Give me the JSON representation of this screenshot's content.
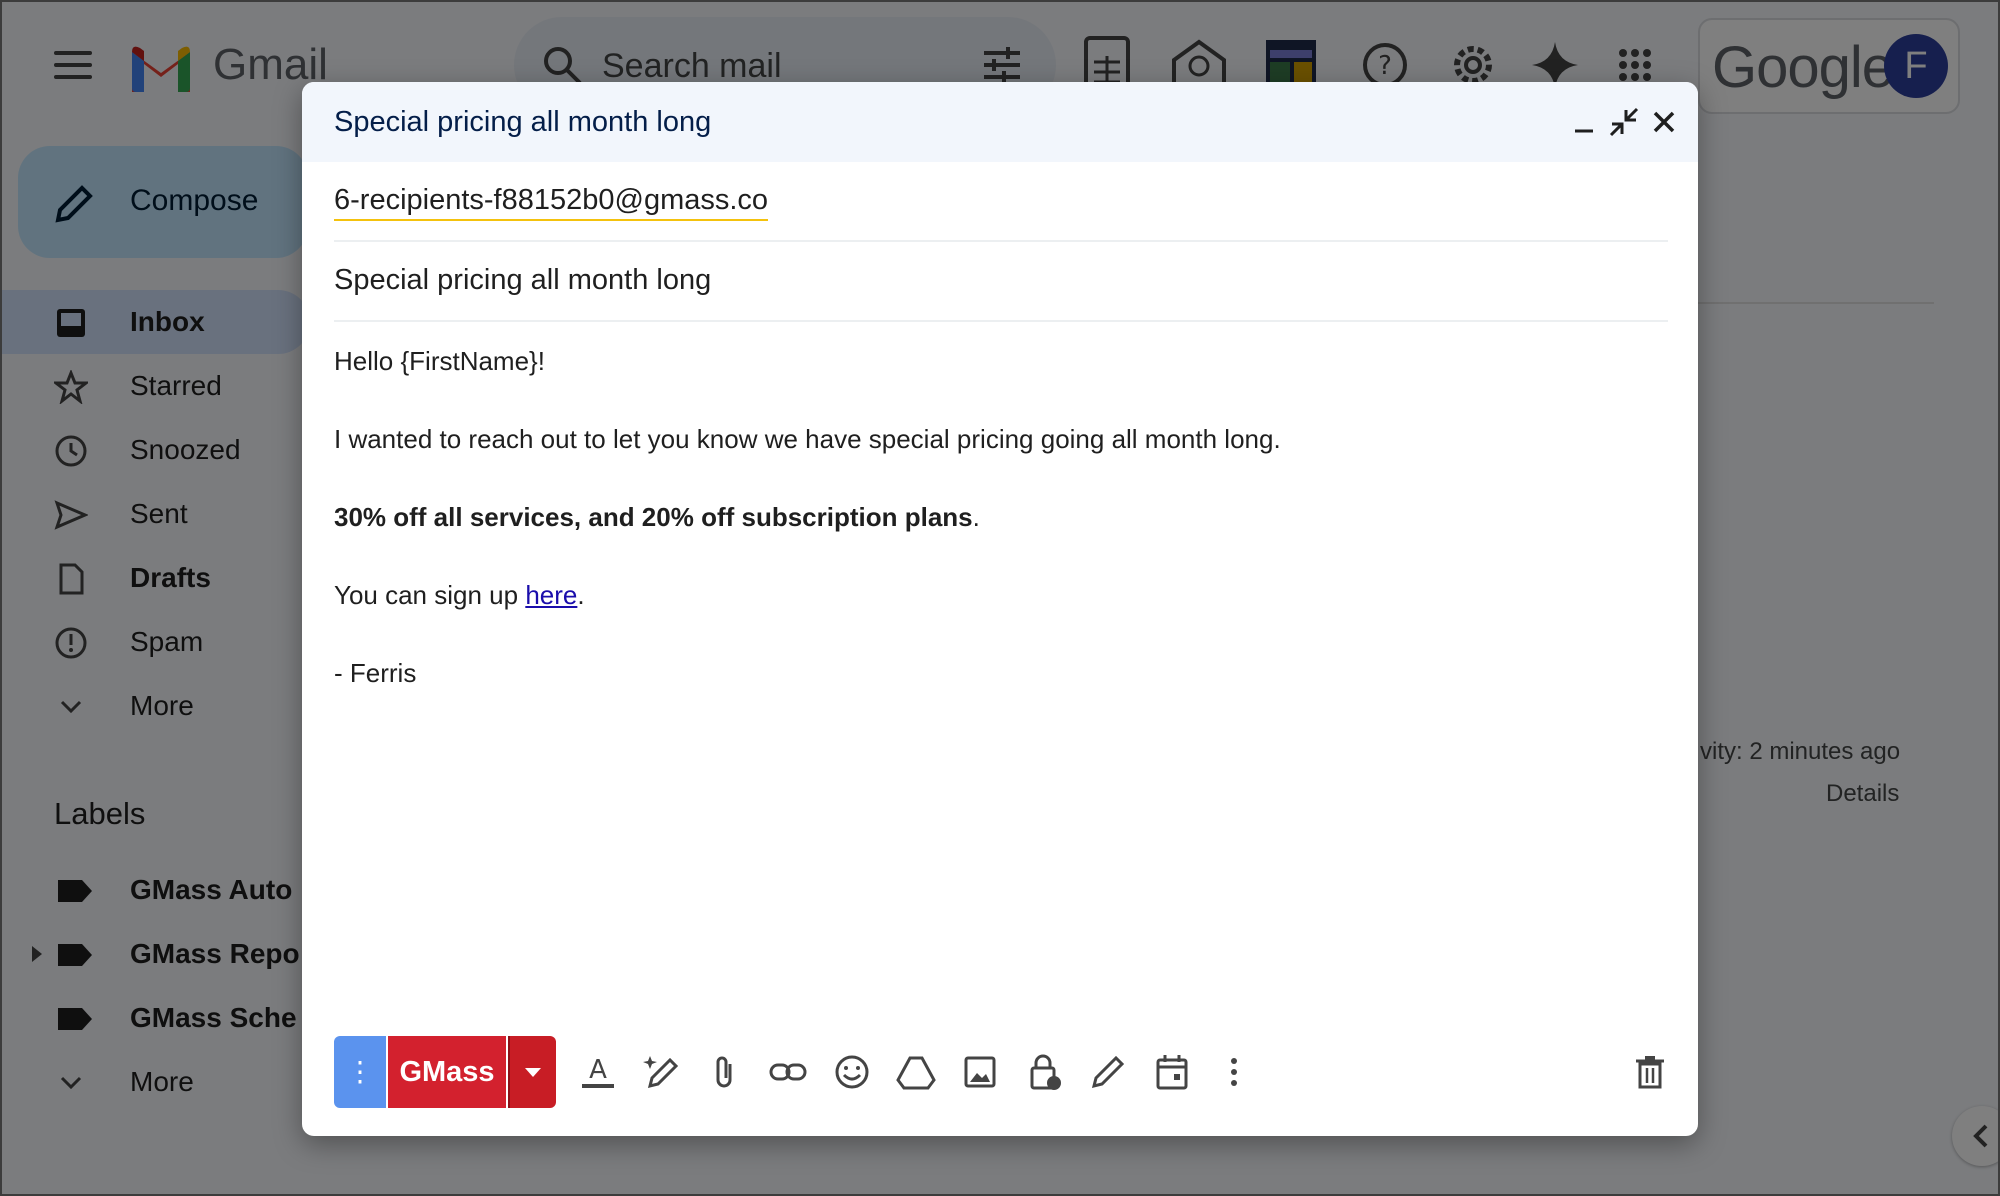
{
  "app": {
    "brand": "Gmail",
    "search_placeholder": "Search mail",
    "google_label": "Google",
    "avatar_initial": "F"
  },
  "sidebar": {
    "compose_label": "Compose",
    "items": [
      {
        "label": "Inbox",
        "icon": "inbox-icon",
        "active": true
      },
      {
        "label": "Starred",
        "icon": "star-icon"
      },
      {
        "label": "Snoozed",
        "icon": "clock-icon"
      },
      {
        "label": "Sent",
        "icon": "send-icon"
      },
      {
        "label": "Drafts",
        "icon": "draft-icon"
      },
      {
        "label": "Spam",
        "icon": "spam-icon"
      },
      {
        "label": "More",
        "icon": "chevron-down-icon"
      }
    ],
    "labels_heading": "Labels",
    "labels": [
      {
        "label": "GMass Auto"
      },
      {
        "label": "GMass Repo"
      },
      {
        "label": "GMass Sche"
      }
    ],
    "labels_more": "More"
  },
  "background": {
    "activity_text": "vity: 2 minutes ago",
    "details_text": "Details"
  },
  "compose": {
    "title": "Special pricing all month long",
    "recipient": "6-recipients-f88152b0@gmass.co",
    "subject": "Special pricing all month long",
    "body": {
      "greeting": "Hello {FirstName}!",
      "line1": "I wanted to reach out to let you know we have special pricing going all month long.",
      "offer_bold": "30% off all services, and 20% off subscription plans",
      "offer_end": ".",
      "signup_prefix": "You can sign up ",
      "signup_link": "here",
      "signup_end": ".",
      "signature": "- Ferris"
    },
    "toolbar": {
      "more_label": "⋮",
      "gmass_label": "GMass"
    }
  },
  "colors": {
    "gmass_red": "#d3212e",
    "gmass_blue": "#5b93ee",
    "link": "#1a0dab",
    "header_bg": "#f2f6fc"
  }
}
